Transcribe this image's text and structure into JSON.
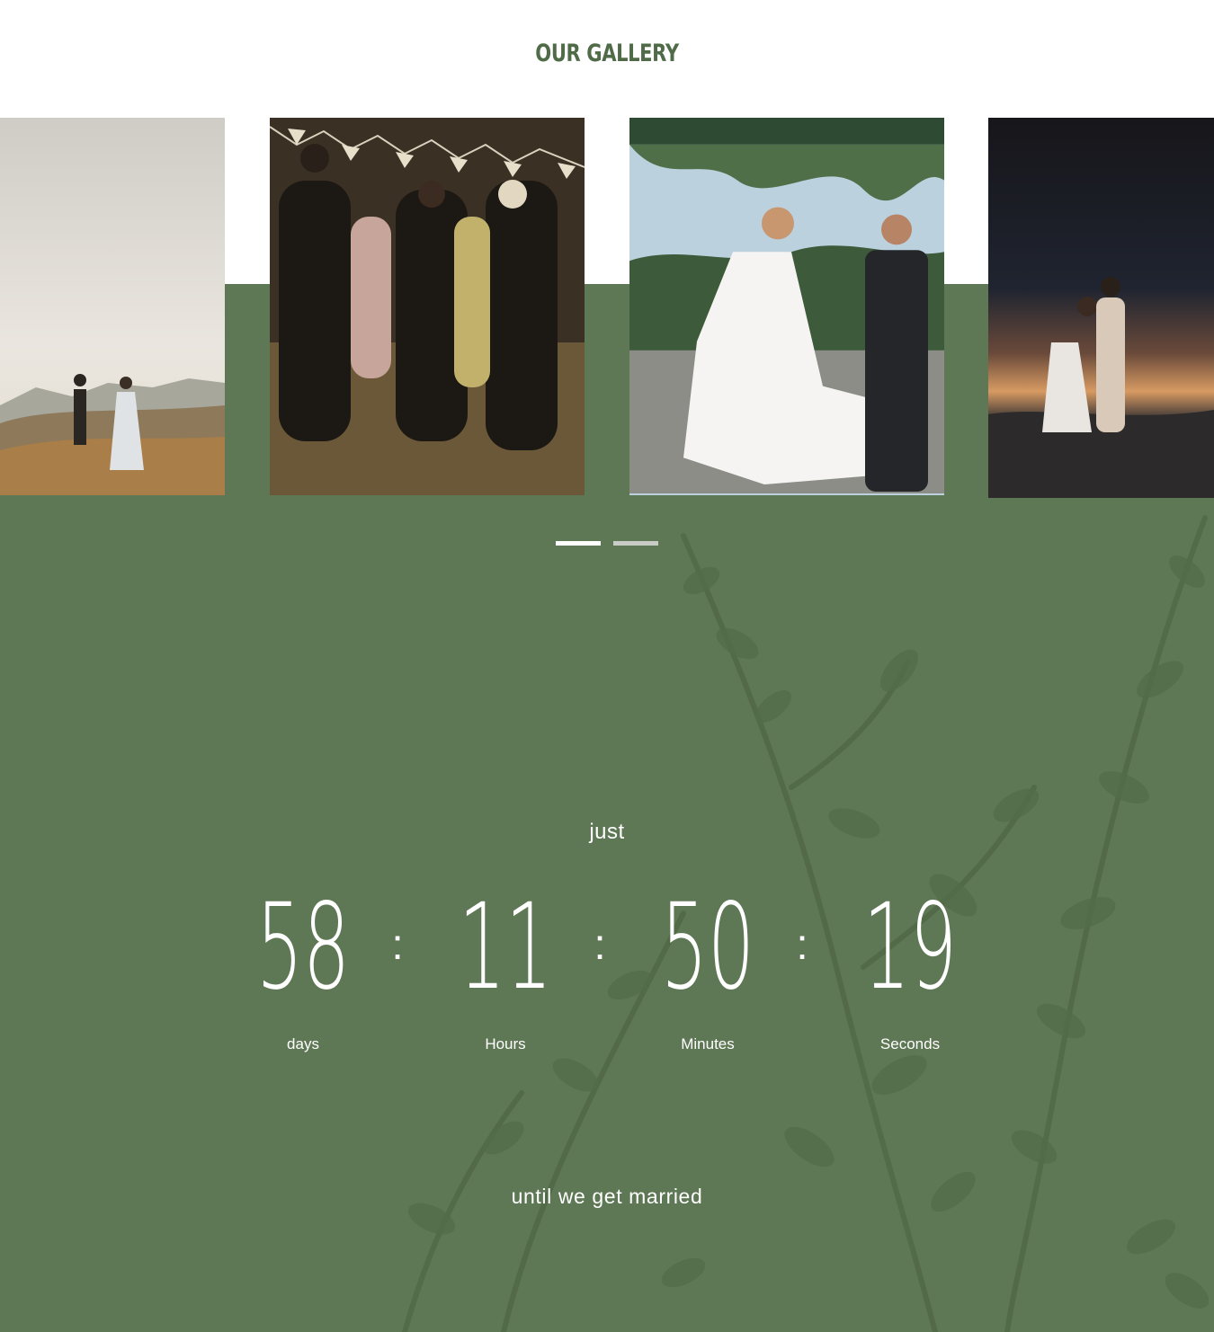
{
  "gallery": {
    "title": "OUR GALLERY",
    "slides": [
      {
        "name": "couple-walking-field-photo"
      },
      {
        "name": "guests-dancing-photo"
      },
      {
        "name": "bride-groom-ceremony-photo"
      },
      {
        "name": "couple-sunset-beach-photo"
      }
    ],
    "active_dot": 0,
    "dot_count": 2
  },
  "countdown": {
    "intro": "just",
    "days": "58",
    "hours": "11",
    "minutes": "50",
    "seconds": "19",
    "separator": ":",
    "labels": {
      "days": "days",
      "hours": "Hours",
      "minutes": "Minutes",
      "seconds": "Seconds"
    },
    "outro": "until we get married"
  },
  "colors": {
    "green": "#5e7754",
    "title_green": "#4f6b47",
    "dot_active": "#ffffff",
    "dot_inactive": "#c9ccc6"
  }
}
